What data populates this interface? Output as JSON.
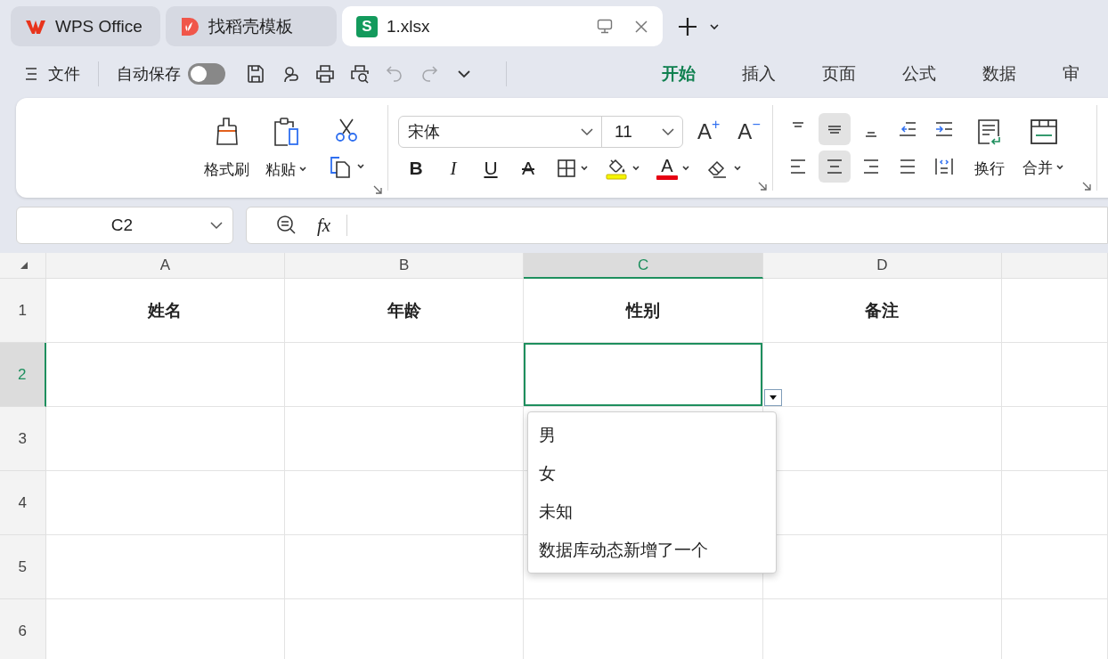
{
  "app_tabs": [
    {
      "label": "WPS Office",
      "kind": "home",
      "selected": false
    },
    {
      "label": "找稻壳模板",
      "kind": "template",
      "selected": false
    },
    {
      "label": "1.xlsx",
      "kind": "sheet",
      "badge": "S",
      "selected": true
    }
  ],
  "toolbar": {
    "file_label": "文件",
    "autosave_label": "自动保存",
    "autosave_on": false,
    "undo_disabled": true,
    "redo_disabled": true
  },
  "ribbon_tabs": [
    {
      "label": "开始",
      "selected": true
    },
    {
      "label": "插入",
      "selected": false
    },
    {
      "label": "页面",
      "selected": false
    },
    {
      "label": "公式",
      "selected": false
    },
    {
      "label": "数据",
      "selected": false
    },
    {
      "label": "审",
      "selected": false
    }
  ],
  "ribbon": {
    "format_painter": "格式刷",
    "paste": "粘贴",
    "font": "宋体",
    "size": "11",
    "grow": "A",
    "grow_sign": "+",
    "shrink": "A",
    "shrink_sign": "−",
    "text_styles": [
      {
        "kind": "bold",
        "label": "B"
      },
      {
        "kind": "italic",
        "label": "I"
      },
      {
        "kind": "underline",
        "label": "U"
      },
      {
        "kind": "strike",
        "label": "A"
      }
    ],
    "font_color_label": "A",
    "align_buttons": [
      {
        "kind": "top",
        "selected": false
      },
      {
        "kind": "middle",
        "selected": true
      },
      {
        "kind": "bottom",
        "selected": false
      },
      {
        "kind": "outdent",
        "selected": false
      },
      {
        "kind": "indent",
        "selected": false
      },
      {
        "kind": "left",
        "selected": false
      },
      {
        "kind": "center",
        "selected": true
      },
      {
        "kind": "right",
        "selected": false
      },
      {
        "kind": "justify",
        "selected": false
      },
      {
        "kind": "distributed",
        "selected": false
      }
    ],
    "wrap": "换行",
    "merge": "合并"
  },
  "formula_bar": {
    "cell_ref": "C2",
    "fx": "fx"
  },
  "sheet": {
    "columns": [
      {
        "label": "A",
        "selected": false
      },
      {
        "label": "B",
        "selected": false
      },
      {
        "label": "C",
        "selected": true
      },
      {
        "label": "D",
        "selected": false
      }
    ],
    "rows": [
      {
        "label": "1",
        "selected": false,
        "cells": [
          "姓名",
          "年龄",
          "性别",
          "备注"
        ]
      },
      {
        "label": "2",
        "selected": true
      },
      {
        "label": "3",
        "selected": false
      },
      {
        "label": "4",
        "selected": false
      },
      {
        "label": "5",
        "selected": false
      },
      {
        "label": "6",
        "selected": false
      }
    ]
  },
  "dropdown": {
    "options": [
      "男",
      "女",
      "未知",
      "数据库动态新增了一个"
    ]
  }
}
